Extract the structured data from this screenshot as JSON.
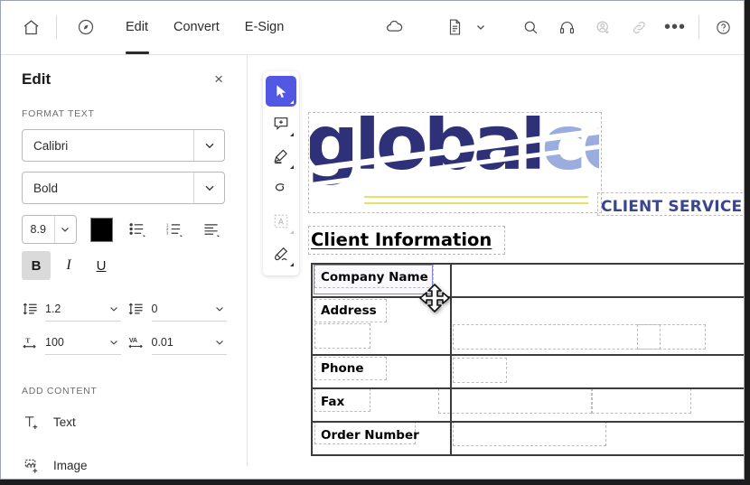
{
  "topbar": {
    "home_icon": "home-icon",
    "scan_icon": "scan-tool-icon",
    "tabs": [
      {
        "label": "Edit",
        "active": true
      },
      {
        "label": "Convert",
        "active": false
      },
      {
        "label": "E-Sign",
        "active": false
      }
    ],
    "cloud_icon": "cloud-icon",
    "document_icon": "document-icon",
    "caret_icon": "chevron-down-icon",
    "right_icons": [
      {
        "name": "search-icon",
        "enabled": true
      },
      {
        "name": "headphones-icon",
        "enabled": true
      },
      {
        "name": "add-person-icon",
        "enabled": false
      },
      {
        "name": "link-icon",
        "enabled": false
      },
      {
        "name": "more-options-icon",
        "enabled": true
      },
      {
        "name": "help-icon",
        "enabled": true
      }
    ]
  },
  "panel": {
    "title": "Edit",
    "close_label": "×",
    "format_section_label": "FORMAT TEXT",
    "font_family": "Calibri",
    "font_style": "Bold",
    "font_size": "8.9",
    "text_color": "#000000",
    "bullet_list_icon": "bulleted-list-icon",
    "numbered_list_icon": "numbered-list-icon",
    "align_icon": "text-align-icon",
    "bold_label": "B",
    "italic_label": "I",
    "underline_label": "U",
    "bold_active": true,
    "line_spacing": "1.2",
    "paragraph_spacing": "0",
    "horizontal_scale": "100",
    "character_spacing": "0.01",
    "line_spacing_icon": "line-spacing-icon",
    "paragraph_spacing_icon": "paragraph-spacing-icon",
    "horizontal_scale_icon": "horizontal-scale-icon",
    "character_spacing_icon": "character-spacing-icon",
    "add_section_label": "ADD CONTENT",
    "add_text_label": "Text",
    "add_image_label": "Image"
  },
  "toolrail": {
    "tools": [
      {
        "name": "select-tool",
        "active": true,
        "disabled": false,
        "has_menu": true
      },
      {
        "name": "comment-tool",
        "active": false,
        "disabled": false,
        "has_menu": true
      },
      {
        "name": "highlight-tool",
        "active": false,
        "disabled": false,
        "has_menu": true
      },
      {
        "name": "draw-lasso-tool",
        "active": false,
        "disabled": false,
        "has_menu": false
      },
      {
        "name": "text-select-tool",
        "active": false,
        "disabled": true,
        "has_menu": true
      },
      {
        "name": "signature-tool",
        "active": false,
        "disabled": false,
        "has_menu": true
      }
    ]
  },
  "document": {
    "logo": {
      "primary_text": "global",
      "secondary_text": "corp",
      "primary_color": "#2e3178",
      "secondary_color": "#9aadde",
      "accent_color": "#e8e06a"
    },
    "client_service_text": "CLIENT SERVICE",
    "client_service_color": "#3a4590",
    "heading": "Client Information",
    "table": {
      "rows": [
        {
          "label": "Company Name",
          "value": "",
          "tall": false
        },
        {
          "label": "Address",
          "value": "",
          "tall": true
        },
        {
          "label": "Phone",
          "value": "",
          "tall": false
        },
        {
          "label": "Fax",
          "value": "",
          "tall": false
        },
        {
          "label": "Order Number",
          "value": "",
          "tall": false
        }
      ]
    },
    "selected_field": "Company Name",
    "cursor": "move-cursor"
  }
}
